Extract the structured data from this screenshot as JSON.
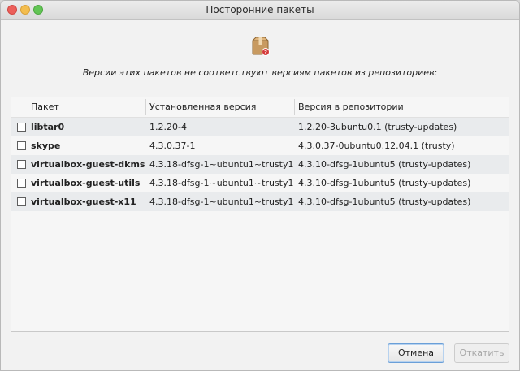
{
  "window": {
    "title": "Посторонние пакеты"
  },
  "dialog": {
    "icon": "package-question-icon",
    "message": "Версии этих пакетов не соответствуют версиям пакетов из репозиториев:"
  },
  "table": {
    "columns": [
      "Пакет",
      "Установленная версия",
      "Версия в репозитории"
    ],
    "rows": [
      {
        "name": "libtar0",
        "installed": "1.2.20-4",
        "repo": "1.2.20-3ubuntu0.1 (trusty-updates)"
      },
      {
        "name": "skype",
        "installed": "4.3.0.37-1",
        "repo": "4.3.0.37-0ubuntu0.12.04.1 (trusty)"
      },
      {
        "name": "virtualbox-guest-dkms",
        "installed": "4.3.18-dfsg-1~ubuntu1~trusty1",
        "repo": "4.3.10-dfsg-1ubuntu5 (trusty-updates)"
      },
      {
        "name": "virtualbox-guest-utils",
        "installed": "4.3.18-dfsg-1~ubuntu1~trusty1",
        "repo": "4.3.10-dfsg-1ubuntu5 (trusty-updates)"
      },
      {
        "name": "virtualbox-guest-x11",
        "installed": "4.3.18-dfsg-1~ubuntu1~trusty1",
        "repo": "4.3.10-dfsg-1ubuntu5 (trusty-updates)"
      }
    ]
  },
  "buttons": {
    "cancel": "Отмена",
    "apply": "Откатить"
  }
}
